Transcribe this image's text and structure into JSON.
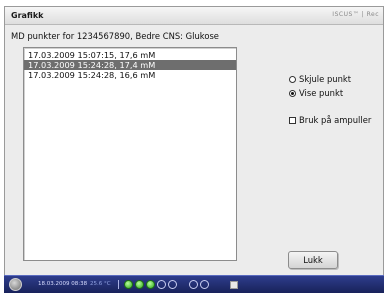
{
  "window": {
    "title": "Grafikk",
    "brand": "ISCUS™ | Rec"
  },
  "subtitle": "MD punkter for 1234567890, Bedre CNS: Glukose",
  "list": {
    "items": [
      {
        "label": "17.03.2009 15:07:15, 17,6 mM",
        "selected": false
      },
      {
        "label": "17.03.2009 15:24:28, 17,4 mM",
        "selected": true
      },
      {
        "label": "17.03.2009 15:24:28, 16,6 mM",
        "selected": false
      }
    ]
  },
  "options": {
    "hide_label": "Skjule punkt",
    "show_label": "Vise punkt",
    "selected": "show",
    "ampoule_label": "Bruk på ampuller",
    "ampoule_checked": false
  },
  "buttons": {
    "close_label": "Lukk"
  },
  "taskbar": {
    "datetime": "18.03.2009 08:38",
    "temperature": "25.6 °C",
    "status_leds": [
      "green",
      "green",
      "green",
      "empty",
      "empty",
      "empty",
      "empty"
    ]
  }
}
